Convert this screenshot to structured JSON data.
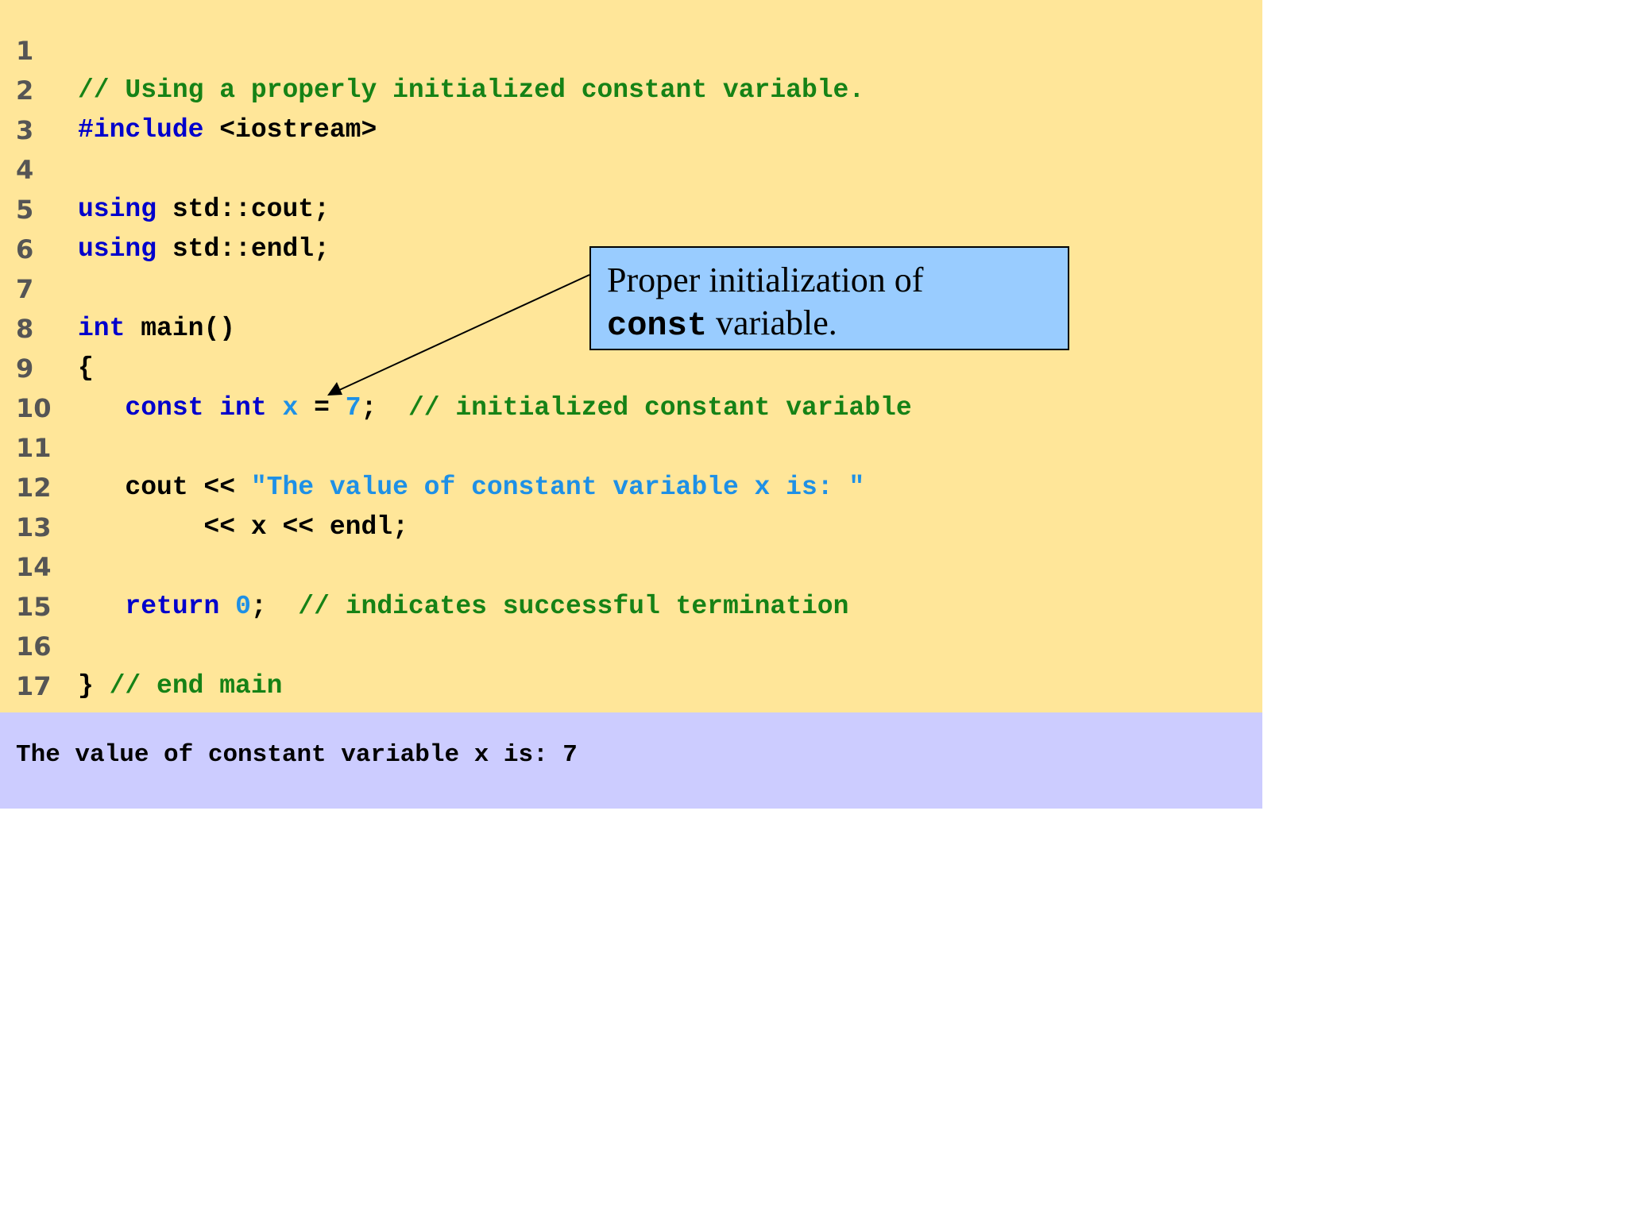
{
  "code": {
    "lines": [
      {
        "number": "1",
        "tokens": []
      },
      {
        "number": "2",
        "tokens": [
          {
            "t": "comment",
            "s": "// Using a properly initialized constant variable."
          }
        ]
      },
      {
        "number": "3",
        "tokens": [
          {
            "t": "keyword",
            "s": "#include"
          },
          {
            "t": "plain",
            "s": " <iostream>"
          }
        ]
      },
      {
        "number": "4",
        "tokens": []
      },
      {
        "number": "5",
        "tokens": [
          {
            "t": "keyword",
            "s": "using"
          },
          {
            "t": "plain",
            "s": " std::cout;"
          }
        ]
      },
      {
        "number": "6",
        "tokens": [
          {
            "t": "keyword",
            "s": "using"
          },
          {
            "t": "plain",
            "s": " std::endl;"
          }
        ]
      },
      {
        "number": "7",
        "tokens": []
      },
      {
        "number": "8",
        "tokens": [
          {
            "t": "keyword",
            "s": "int"
          },
          {
            "t": "plain",
            "s": " main()"
          }
        ]
      },
      {
        "number": "9",
        "tokens": [
          {
            "t": "plain",
            "s": "{"
          }
        ]
      },
      {
        "number": "10",
        "tokens": [
          {
            "t": "plain",
            "s": "   "
          },
          {
            "t": "keyword",
            "s": "const int"
          },
          {
            "t": "plain",
            "s": " "
          },
          {
            "t": "literal",
            "s": "x"
          },
          {
            "t": "plain",
            "s": " = "
          },
          {
            "t": "literal",
            "s": "7"
          },
          {
            "t": "plain",
            "s": ";  "
          },
          {
            "t": "comment",
            "s": "// initialized constant variable"
          }
        ]
      },
      {
        "number": "11",
        "tokens": []
      },
      {
        "number": "12",
        "tokens": [
          {
            "t": "plain",
            "s": "   cout << "
          },
          {
            "t": "literal",
            "s": "\"The value of constant variable x is: \""
          }
        ]
      },
      {
        "number": "13",
        "tokens": [
          {
            "t": "plain",
            "s": "        << x << endl;"
          }
        ]
      },
      {
        "number": "14",
        "tokens": []
      },
      {
        "number": "15",
        "tokens": [
          {
            "t": "plain",
            "s": "   "
          },
          {
            "t": "keyword",
            "s": "return"
          },
          {
            "t": "plain",
            "s": " "
          },
          {
            "t": "literal",
            "s": "0"
          },
          {
            "t": "plain",
            "s": ";  "
          },
          {
            "t": "comment",
            "s": "// indicates successful termination"
          }
        ]
      },
      {
        "number": "16",
        "tokens": []
      },
      {
        "number": "17",
        "tokens": [
          {
            "t": "plain",
            "s": "} "
          },
          {
            "t": "comment",
            "s": "// end main"
          }
        ]
      }
    ]
  },
  "output": {
    "text": "The value of constant variable x is: 7"
  },
  "callout": {
    "line1": "Proper initialization of",
    "code_word": "const",
    "line2_rest": " variable."
  },
  "colors": {
    "code_background": "#ffe699",
    "output_background": "#ccccff",
    "callout_background": "#99ccff",
    "comment": "#168216",
    "keyword": "#0000cc",
    "literal": "#1e90e6",
    "line_number": "#555555"
  }
}
